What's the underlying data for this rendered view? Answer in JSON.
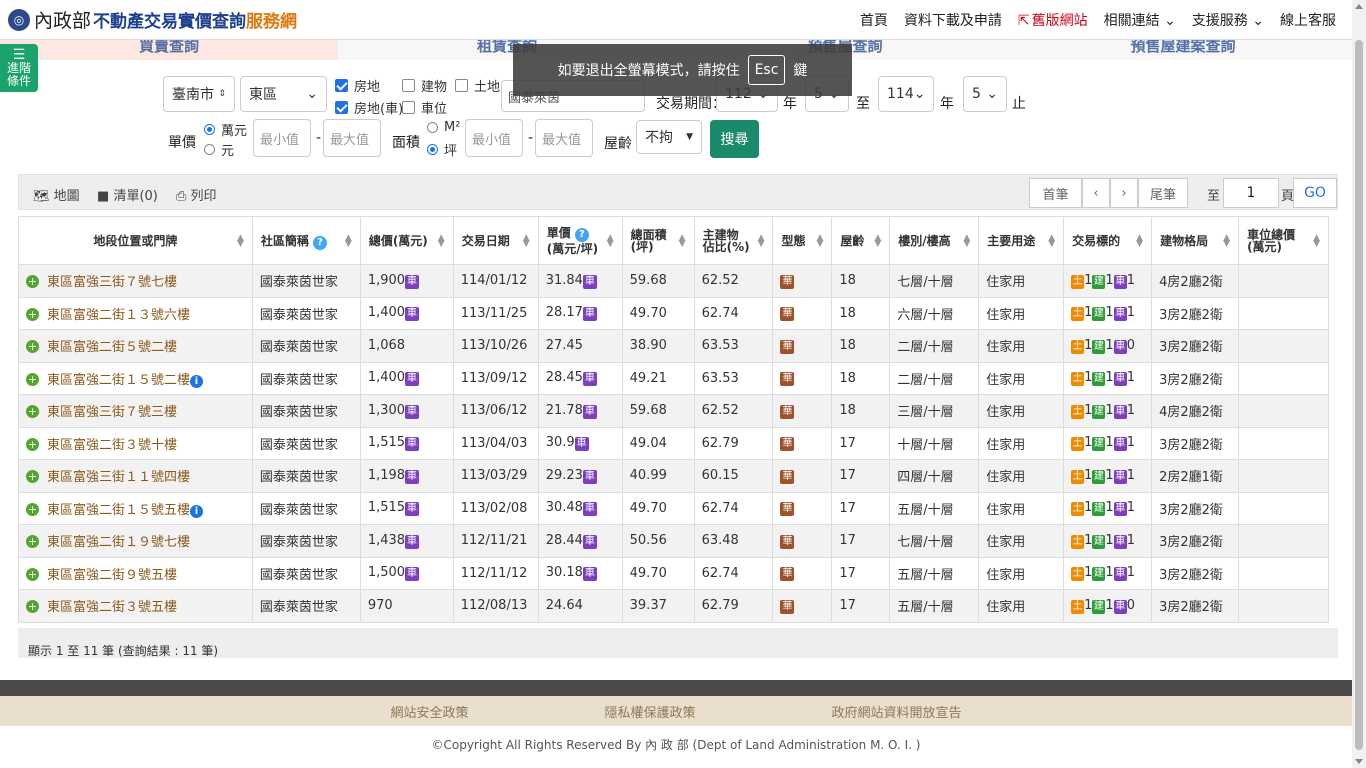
{
  "header": {
    "logo_moi": "內政部",
    "logo_title": "不動產交易實價查詢",
    "logo_service": "服務網",
    "nav": [
      "首頁",
      "資料下載及申請",
      "舊版網站",
      "相關連結",
      "支援服務",
      "線上客服"
    ]
  },
  "banner": [
    "買賣查詢",
    "租賃查詢",
    "預售屋查詢",
    "預售屋建案查詢"
  ],
  "advanced_button": {
    "line1": "進階",
    "line2": "條件"
  },
  "toast": {
    "before": "如要退出全螢幕模式，請按住",
    "key": "Esc",
    "after": "鍵"
  },
  "search": {
    "city": "臺南市",
    "district": "東區",
    "types": [
      {
        "label": "房地",
        "checked": true
      },
      {
        "label": "建物",
        "checked": false
      },
      {
        "label": "土地",
        "checked": false
      },
      {
        "label": "房地(車)",
        "checked": true
      },
      {
        "label": "車位",
        "checked": false
      }
    ],
    "keyword": "國泰萊茵",
    "period_label": "交易期間：",
    "from_year": "112",
    "from_month": "5",
    "to_word": "至",
    "to_year": "114",
    "to_month": "5",
    "year_word": "年",
    "end_word": "止",
    "unit_price_label": "單價",
    "unit_options": [
      "萬元",
      "元"
    ],
    "min_placeholder": "最小值",
    "max_placeholder": "最大值",
    "area_label": "面積",
    "area_options": [
      "M²",
      "坪"
    ],
    "age_label": "屋齡",
    "age_value": "不拘",
    "search_button": "搜尋"
  },
  "toolbar": {
    "map": "地圖",
    "list": "清單(0)",
    "print": "列印",
    "first": "首筆",
    "prev": "‹",
    "next": "›",
    "last": "尾筆",
    "to": "至",
    "page": "1",
    "page_word": "頁",
    "go": "GO"
  },
  "table": {
    "headers": [
      "地段位置或門牌",
      "社區簡稱",
      "總價(萬元)",
      "交易日期",
      "單價\n(萬元/坪)",
      "總面積\n(坪)",
      "主建物\n佔比(%)",
      "型態",
      "屋齡",
      "樓別/樓高",
      "主要用途",
      "交易標的",
      "建物格局",
      "車位總價\n(萬元)"
    ],
    "rows": [
      {
        "addr": "東區富強三街７號七樓",
        "info": false,
        "community": "國泰萊茵世家",
        "total": "1,900",
        "total_car": true,
        "date": "114/01/12",
        "unit": "31.84",
        "unit_car": true,
        "area": "59.68",
        "ratio": "62.52",
        "type": "華",
        "age": "18",
        "floor": "七層/十層",
        "use": "住家用",
        "land": "1",
        "bld": "1",
        "car": "1",
        "layout": "4房2廳2衛"
      },
      {
        "addr": "東區富強二街１３號六樓",
        "info": false,
        "community": "國泰萊茵世家",
        "total": "1,400",
        "total_car": true,
        "date": "113/11/25",
        "unit": "28.17",
        "unit_car": true,
        "area": "49.70",
        "ratio": "62.74",
        "type": "華",
        "age": "18",
        "floor": "六層/十層",
        "use": "住家用",
        "land": "1",
        "bld": "1",
        "car": "1",
        "layout": "3房2廳2衛"
      },
      {
        "addr": "東區富強二街５號二樓",
        "info": false,
        "community": "國泰萊茵世家",
        "total": "1,068",
        "total_car": false,
        "date": "113/10/26",
        "unit": "27.45",
        "unit_car": false,
        "area": "38.90",
        "ratio": "63.53",
        "type": "華",
        "age": "18",
        "floor": "二層/十層",
        "use": "住家用",
        "land": "1",
        "bld": "1",
        "car": "0",
        "layout": "3房2廳2衛"
      },
      {
        "addr": "東區富強二街１５號二樓",
        "info": true,
        "community": "國泰萊茵世家",
        "total": "1,400",
        "total_car": true,
        "date": "113/09/12",
        "unit": "28.45",
        "unit_car": true,
        "area": "49.21",
        "ratio": "63.53",
        "type": "華",
        "age": "18",
        "floor": "二層/十層",
        "use": "住家用",
        "land": "1",
        "bld": "1",
        "car": "1",
        "layout": "3房2廳2衛"
      },
      {
        "addr": "東區富強三街７號三樓",
        "info": false,
        "community": "國泰萊茵世家",
        "total": "1,300",
        "total_car": true,
        "date": "113/06/12",
        "unit": "21.78",
        "unit_car": true,
        "area": "59.68",
        "ratio": "62.52",
        "type": "華",
        "age": "18",
        "floor": "三層/十層",
        "use": "住家用",
        "land": "1",
        "bld": "1",
        "car": "1",
        "layout": "4房2廳2衛"
      },
      {
        "addr": "東區富強二街３號十樓",
        "info": false,
        "community": "國泰萊茵世家",
        "total": "1,515",
        "total_car": true,
        "date": "113/04/03",
        "unit": "30.9",
        "unit_car": true,
        "area": "49.04",
        "ratio": "62.79",
        "type": "華",
        "age": "17",
        "floor": "十層/十層",
        "use": "住家用",
        "land": "1",
        "bld": "1",
        "car": "1",
        "layout": "3房2廳2衛"
      },
      {
        "addr": "東區富強三街１１號四樓",
        "info": false,
        "community": "國泰萊茵世家",
        "total": "1,198",
        "total_car": true,
        "date": "113/03/29",
        "unit": "29.23",
        "unit_car": true,
        "area": "40.99",
        "ratio": "60.15",
        "type": "華",
        "age": "17",
        "floor": "四層/十層",
        "use": "住家用",
        "land": "1",
        "bld": "1",
        "car": "1",
        "layout": "2房2廳1衛"
      },
      {
        "addr": "東區富強二街１５號五樓",
        "info": true,
        "community": "國泰萊茵世家",
        "total": "1,515",
        "total_car": true,
        "date": "113/02/08",
        "unit": "30.48",
        "unit_car": true,
        "area": "49.70",
        "ratio": "62.74",
        "type": "華",
        "age": "17",
        "floor": "五層/十層",
        "use": "住家用",
        "land": "1",
        "bld": "1",
        "car": "1",
        "layout": "3房2廳2衛"
      },
      {
        "addr": "東區富強二街１９號七樓",
        "info": false,
        "community": "國泰萊茵世家",
        "total": "1,438",
        "total_car": true,
        "date": "112/11/21",
        "unit": "28.44",
        "unit_car": true,
        "area": "50.56",
        "ratio": "63.48",
        "type": "華",
        "age": "17",
        "floor": "七層/十層",
        "use": "住家用",
        "land": "1",
        "bld": "1",
        "car": "1",
        "layout": "3房2廳2衛"
      },
      {
        "addr": "東區富強二街９號五樓",
        "info": false,
        "community": "國泰萊茵世家",
        "total": "1,500",
        "total_car": true,
        "date": "112/11/12",
        "unit": "30.18",
        "unit_car": true,
        "area": "49.70",
        "ratio": "62.74",
        "type": "華",
        "age": "17",
        "floor": "五層/十層",
        "use": "住家用",
        "land": "1",
        "bld": "1",
        "car": "1",
        "layout": "3房2廳2衛"
      },
      {
        "addr": "東區富強二街３號五樓",
        "info": false,
        "community": "國泰萊茵世家",
        "total": "970",
        "total_car": false,
        "date": "112/08/13",
        "unit": "24.64",
        "unit_car": false,
        "area": "39.37",
        "ratio": "62.79",
        "type": "華",
        "age": "17",
        "floor": "五層/十層",
        "use": "住家用",
        "land": "1",
        "bld": "1",
        "car": "0",
        "layout": "3房2廳2衛"
      }
    ],
    "badge_car": "車",
    "badge_land": "土",
    "badge_bld": "建",
    "badge_car2": "車"
  },
  "result_info": "顯示 1 至 11 筆 (查詢結果 : 11 筆)",
  "footer": {
    "links": [
      "網站安全政策",
      "隱私權保護政策",
      "政府網站資料開放宣告"
    ],
    "copyright": "©Copyright All Rights Reserved By 內 政 部 (Dept of Land Administration M. O. I. )"
  }
}
